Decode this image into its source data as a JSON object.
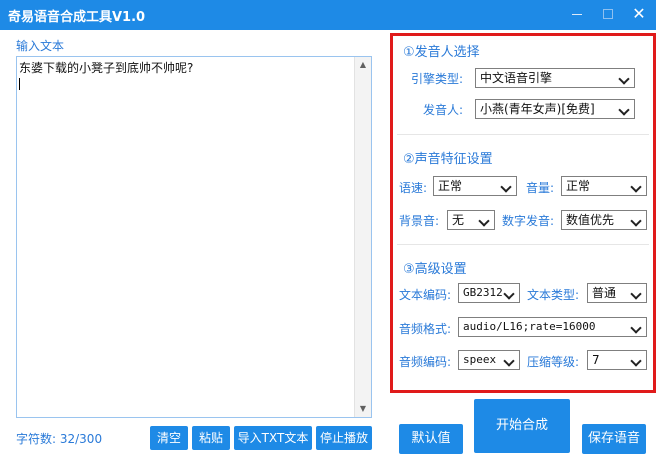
{
  "app": {
    "title": "奇易语音合成工具V1.0",
    "close_glyph": "✕"
  },
  "left": {
    "input_label": "输入文本",
    "text": "东婆下载的小凳子到底帅不帅呢?",
    "char_count": "字符数: 32/300",
    "buttons": {
      "clear": "清空",
      "paste": "粘贴",
      "import_txt": "导入TXT文本",
      "stop": "停止播放"
    }
  },
  "panel": {
    "s1": {
      "title": "①发音人选择",
      "engine_label": "引擎类型:",
      "engine_value": "中文语音引擎",
      "voice_label": "发音人:",
      "voice_value": "小燕(青年女声)[免费]"
    },
    "s2": {
      "title": "②声音特征设置",
      "speed_label": "语速:",
      "speed_value": "正常",
      "volume_label": "音量:",
      "volume_value": "正常",
      "bg_label": "背景音:",
      "bg_value": "无",
      "digit_label": "数字发音:",
      "digit_value": "数值优先"
    },
    "s3": {
      "title": "③高级设置",
      "encoding_label": "文本编码:",
      "encoding_value": "GB2312",
      "texttype_label": "文本类型:",
      "texttype_value": "普通",
      "format_label": "音频格式:",
      "format_value": "audio/L16;rate=16000",
      "codec_label": "音频编码:",
      "codec_value": "speex",
      "compress_label": "压缩等级:",
      "compress_value": "7"
    }
  },
  "actions": {
    "default": "默认值",
    "start": "开始合成",
    "save": "保存语音"
  },
  "colors": {
    "accent": "#1e8ae6",
    "label_blue": "#2a7ad8",
    "highlight_border": "#e01a1a"
  }
}
